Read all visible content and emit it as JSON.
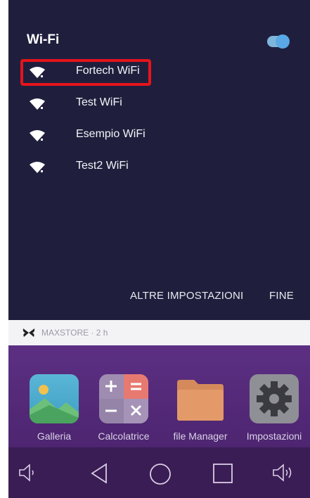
{
  "wifi": {
    "title": "Wi-Fi",
    "enabled": true,
    "networks": [
      {
        "name": "Fortech WiFi"
      },
      {
        "name": "Test WiFi"
      },
      {
        "name": "Esempio WiFi"
      },
      {
        "name": "Test2 WiFi"
      }
    ],
    "more_settings_label": "ALTRE IMPOSTAZIONI",
    "done_label": "FINE"
  },
  "notification": {
    "text": "MAXSTORE · 2 h"
  },
  "apps": [
    {
      "label": "Galleria"
    },
    {
      "label": "Calcolatrice"
    },
    {
      "label": "file Manager"
    },
    {
      "label": "Impostazioni"
    }
  ],
  "colors": {
    "highlight": "#e6141b",
    "panel_bg": "#1f1f3d",
    "toggle_on": "#5aa8e6"
  },
  "icons": {
    "network": "wifi-locked-icon",
    "notification": "butterfly-icon",
    "nav": [
      "volume-down-icon",
      "back-icon",
      "home-icon",
      "recents-icon",
      "volume-up-icon"
    ]
  }
}
